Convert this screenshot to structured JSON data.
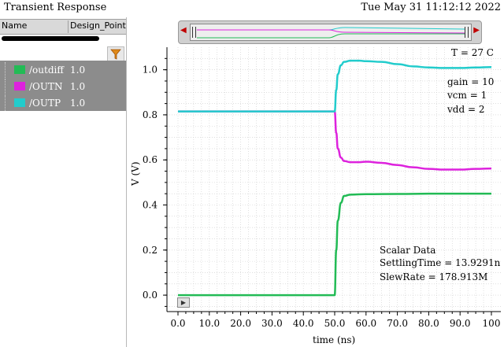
{
  "window": {
    "title": "Transient Response",
    "timestamp": "Tue May 31 11:12:12 2022"
  },
  "browser": {
    "col_name": "Name",
    "col_design": "Design_Point",
    "filter_icon": "funnel-icon",
    "signals": [
      {
        "label": "/outdiff",
        "value": "1.0",
        "color": "#22bb55"
      },
      {
        "label": "/OUTN",
        "value": "1.0",
        "color": "#dd22dd"
      },
      {
        "label": "/OUTP",
        "value": "1.0",
        "color": "#22cccc"
      }
    ]
  },
  "annotations": {
    "temperature": "T = 27 C",
    "params": [
      "gain = 10",
      "vcm = 1",
      "vdd = 2"
    ],
    "scalar_title": "Scalar Data",
    "scalar_lines": [
      "SettlingTime = 13.9291n",
      "SlewRate = 178.913M"
    ]
  },
  "chart_data": {
    "type": "line",
    "xlabel": "time (ns)",
    "ylabel": "V (V)",
    "xlim": [
      0,
      100
    ],
    "ylim": [
      -0.08,
      1.1
    ],
    "xticks": [
      0,
      10,
      20,
      30,
      40,
      50,
      60,
      70,
      80,
      90,
      100
    ],
    "xtick_labels": [
      "0.0",
      "10.0",
      "20.0",
      "30.0",
      "40.0",
      "50.0",
      "60.0",
      "70.0",
      "80.0",
      "90.0",
      "100"
    ],
    "yticks": [
      0.0,
      0.2,
      0.4,
      0.6,
      0.8,
      1.0
    ],
    "ytick_labels": [
      "0.0",
      "0.2",
      "0.4",
      "0.6",
      "0.8",
      "1.0"
    ],
    "grid": true,
    "series": [
      {
        "name": "/outdiff",
        "color": "#22bb55",
        "x": [
          0,
          49.5,
          50,
          50.5,
          51,
          52,
          53,
          55,
          60,
          70,
          80,
          90,
          100
        ],
        "y": [
          0.0,
          0.0,
          0.0,
          0.2,
          0.33,
          0.41,
          0.44,
          0.446,
          0.448,
          0.449,
          0.45,
          0.45,
          0.45
        ]
      },
      {
        "name": "/OUTN",
        "color": "#dd22dd",
        "x": [
          0,
          49.5,
          50,
          50.5,
          51,
          52,
          53,
          55,
          58,
          60,
          65,
          70,
          75,
          80,
          85,
          90,
          95,
          100
        ],
        "y": [
          0.815,
          0.815,
          0.815,
          0.72,
          0.65,
          0.61,
          0.595,
          0.59,
          0.59,
          0.592,
          0.587,
          0.577,
          0.567,
          0.56,
          0.557,
          0.557,
          0.56,
          0.562
        ]
      },
      {
        "name": "/OUTP",
        "color": "#22cccc",
        "x": [
          0,
          49.5,
          50,
          50.5,
          51,
          52,
          53,
          55,
          58,
          60,
          65,
          70,
          75,
          80,
          85,
          90,
          95,
          100
        ],
        "y": [
          0.815,
          0.815,
          0.815,
          0.91,
          0.98,
          1.02,
          1.035,
          1.04,
          1.04,
          1.038,
          1.035,
          1.025,
          1.015,
          1.01,
          1.008,
          1.008,
          1.01,
          1.012
        ]
      }
    ]
  }
}
